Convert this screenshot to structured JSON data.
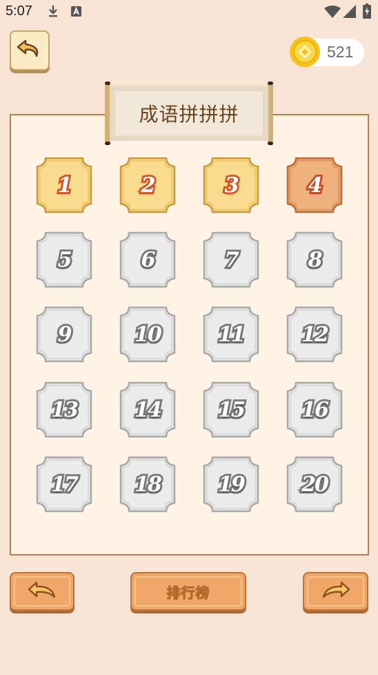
{
  "status_bar": {
    "time": "5:07",
    "icons": [
      "download-icon",
      "text-a-icon",
      "wifi-icon",
      "signal-icon",
      "battery-icon"
    ]
  },
  "header": {
    "coins": "521",
    "back_icon": "undo-arrow-icon",
    "coin_icon": "gold-coin-icon"
  },
  "game": {
    "title": "成语拼拼拼"
  },
  "levels": [
    {
      "label": "1",
      "state": "unlocked"
    },
    {
      "label": "2",
      "state": "unlocked"
    },
    {
      "label": "3",
      "state": "unlocked"
    },
    {
      "label": "4",
      "state": "current"
    },
    {
      "label": "5",
      "state": "locked"
    },
    {
      "label": "6",
      "state": "locked"
    },
    {
      "label": "7",
      "state": "locked"
    },
    {
      "label": "8",
      "state": "locked"
    },
    {
      "label": "9",
      "state": "locked"
    },
    {
      "label": "10",
      "state": "locked"
    },
    {
      "label": "11",
      "state": "locked"
    },
    {
      "label": "12",
      "state": "locked"
    },
    {
      "label": "13",
      "state": "locked"
    },
    {
      "label": "14",
      "state": "locked"
    },
    {
      "label": "15",
      "state": "locked"
    },
    {
      "label": "16",
      "state": "locked"
    },
    {
      "label": "17",
      "state": "locked"
    },
    {
      "label": "18",
      "state": "locked"
    },
    {
      "label": "19",
      "state": "locked"
    },
    {
      "label": "20",
      "state": "locked"
    }
  ],
  "footer": {
    "prev_icon": "arrow-left-icon",
    "rank_label": "排行榜",
    "next_icon": "arrow-right-icon"
  },
  "colors": {
    "background": "#f7e4d4",
    "tile_unlocked": "#f6d27a",
    "tile_current": "#e9a26a",
    "tile_locked": "#e4e4e4",
    "button_wood": "#f0a666"
  }
}
